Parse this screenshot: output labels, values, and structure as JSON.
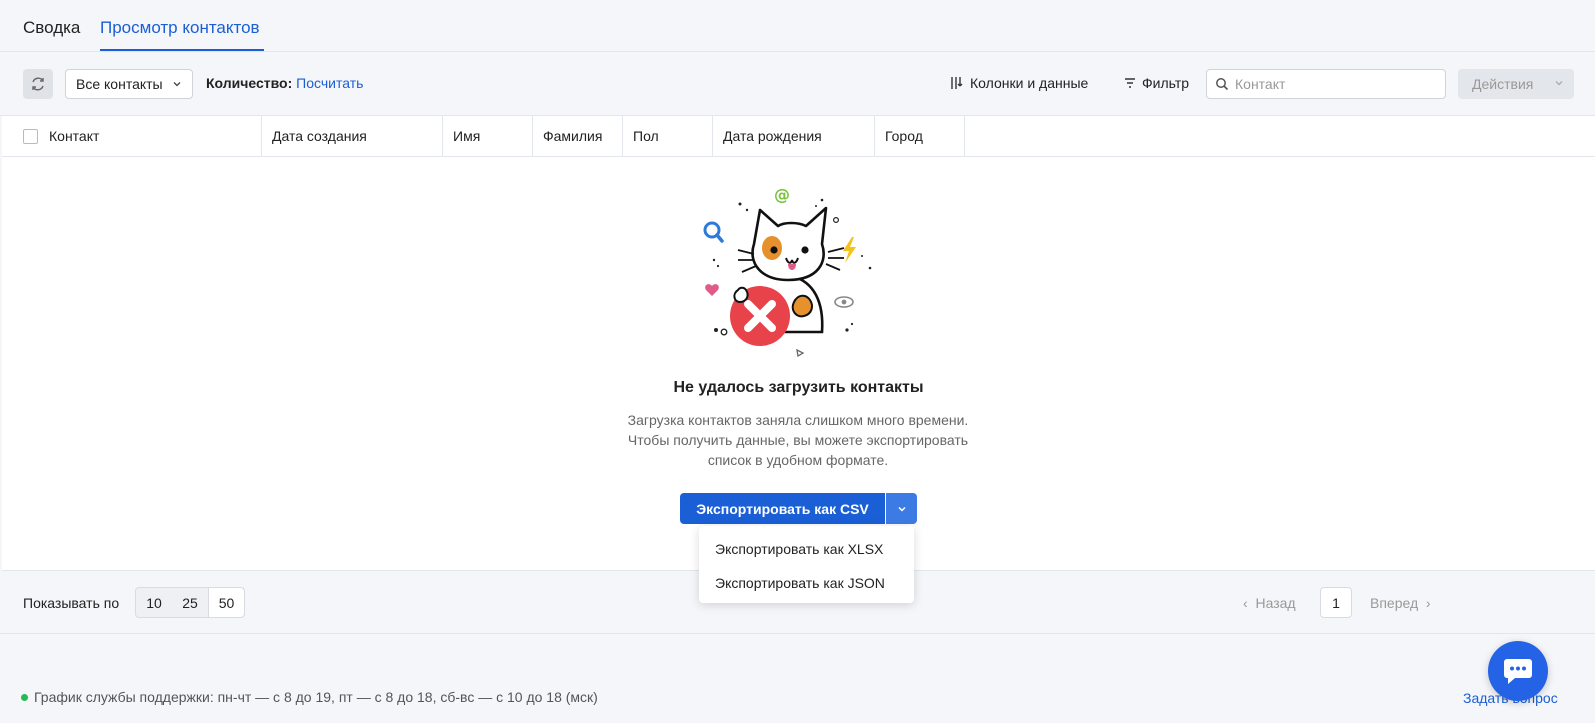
{
  "tabs": [
    {
      "label": "Сводка",
      "active": false
    },
    {
      "label": "Просмотр контактов",
      "active": true
    }
  ],
  "toolbar": {
    "segment_label": "Все контакты",
    "count_label": "Количество:",
    "count_link": "Посчитать",
    "columns_label": "Колонки и данные",
    "filter_label": "Фильтр",
    "search_placeholder": "Контакт",
    "actions_label": "Действия"
  },
  "table": {
    "headers": [
      "Контакт",
      "Дата создания",
      "Имя",
      "Фамилия",
      "Пол",
      "Дата рождения",
      "Город"
    ]
  },
  "empty_state": {
    "title": "Не удалось загрузить контакты",
    "description_lines": [
      "Загрузка контактов заняла слишком много времени.",
      "Чтобы получить данные, вы можете экспортировать",
      "список в удобном формате."
    ],
    "export_button": "Экспортировать как CSV",
    "export_options": [
      "Экспортировать как XLSX",
      "Экспортировать как JSON"
    ]
  },
  "pagination": {
    "show_label": "Показывать по",
    "page_sizes": [
      "10",
      "25",
      "50"
    ],
    "selected_size": "50",
    "prev_label": "Назад",
    "current_page": "1",
    "next_label": "Вперед"
  },
  "footer": {
    "support_text": "График службы поддержки: пн-чт — с 8 до 19, пт — с 8 до 18, сб-вс — с 10 до 18 (мск)",
    "ask_link": "Задать вопрос"
  },
  "colors": {
    "accent": "#1a5fd6",
    "error_red": "#e8434b",
    "status_green": "#22bb55"
  }
}
